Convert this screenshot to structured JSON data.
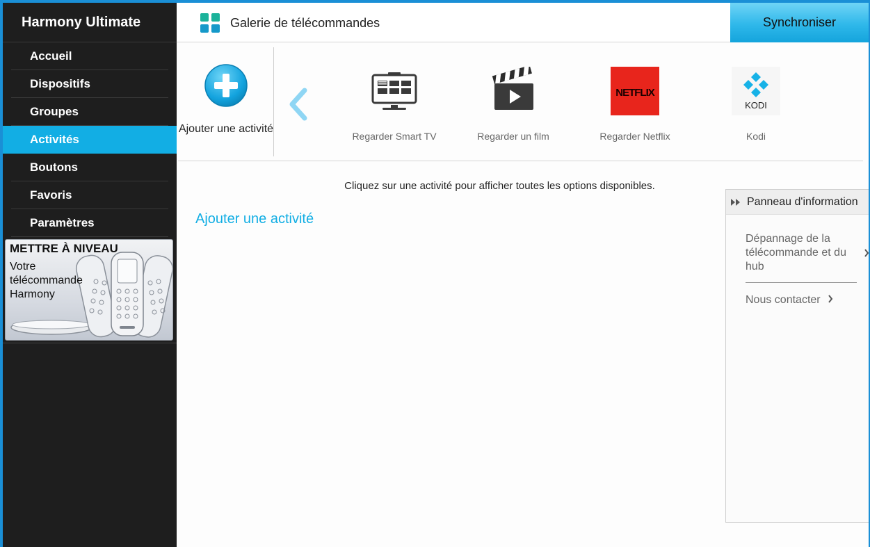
{
  "sidebar": {
    "brand": "Harmony Ultimate",
    "items": [
      {
        "label": "Accueil",
        "active": false
      },
      {
        "label": "Dispositifs",
        "active": false
      },
      {
        "label": "Groupes",
        "active": false
      },
      {
        "label": "Activités",
        "active": true
      },
      {
        "label": "Boutons",
        "active": false
      },
      {
        "label": "Favoris",
        "active": false
      },
      {
        "label": "Paramètres",
        "active": false
      }
    ],
    "upgrade": {
      "title": "METTRE À NIVEAU",
      "text": "Votre télécommande Harmony"
    }
  },
  "header": {
    "gallery_label": "Galerie de télécommandes",
    "gallery_icon": "grid-icon",
    "sync_label": "Synchroniser"
  },
  "carousel": {
    "add_label": "Ajouter une activité",
    "activities": [
      {
        "label": "Regarder Smart TV",
        "icon": "smart-tv-icon"
      },
      {
        "label": "Regarder un film",
        "icon": "clapperboard-icon"
      },
      {
        "label": "Regarder Netflix",
        "icon": "netflix-logo"
      },
      {
        "label": "Kodi",
        "icon": "kodi-logo"
      }
    ],
    "netflix_logo_text": "NETFLIX",
    "kodi_logo_text": "KODI"
  },
  "main": {
    "hint": "Cliquez sur une activité pour afficher toutes les options disponibles.",
    "add_link": "Ajouter une activité"
  },
  "info_panel": {
    "title": "Panneau d'information",
    "links": [
      {
        "label": "Dépannage de la télécommande et du hub"
      },
      {
        "label": "Nous contacter"
      }
    ]
  },
  "colors": {
    "accent": "#12aee4",
    "sidebar_bg": "#1e1e1e",
    "window_frame": "#1a8fd6",
    "netflix_red": "#e50914"
  }
}
